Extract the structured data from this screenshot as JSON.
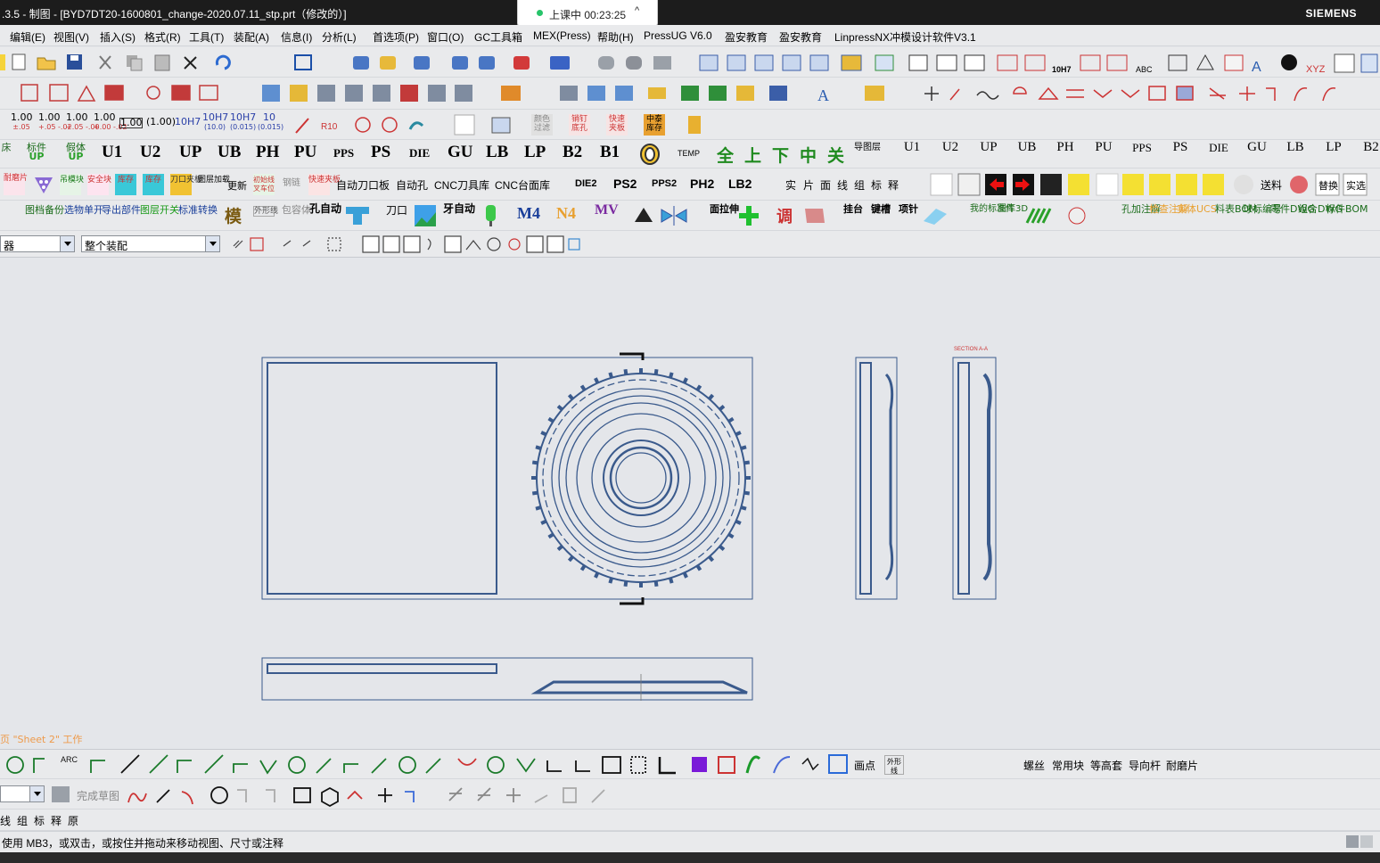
{
  "window": {
    "title": ".3.5 - 制图 - [BYD7DT20-1600801_change-2020.07.11_stp.prt（修改的）]",
    "brand": "SIEMENS"
  },
  "recording": {
    "label": "上课中 00:23:25",
    "chevron": "^"
  },
  "menu": [
    "编辑(E)",
    "视图(V)",
    "插入(S)",
    "格式(R)",
    "工具(T)",
    "装配(A)",
    "信息(I)",
    "分析(L)",
    "首选项(P)",
    "窗口(O)",
    "GC工具箱",
    "MEX(Press)",
    "帮助(H)",
    "PressUG V6.0",
    "盈安教育",
    "盈安教育",
    "LinpressNX冲模设计软件V3.1"
  ],
  "tolerance": [
    "1.00",
    "1.00",
    "1.00",
    "1.00",
    "1.00",
    "(1.00)",
    "10H7",
    "10H7",
    "10H7",
    "10"
  ],
  "row4_big": [
    "U1",
    "U2",
    "UP",
    "UB",
    "PH",
    "PU",
    "PPS",
    "PS",
    "DIE",
    "GU",
    "LB",
    "LP",
    "B2",
    "B1"
  ],
  "row4_small": [
    "U1",
    "U2",
    "UP",
    "UB",
    "PH",
    "PU",
    "PPS",
    "PS",
    "DIE",
    "GU",
    "LB",
    "LP",
    "B2"
  ],
  "row4_misc": {
    "left1": "床",
    "left2": "标件",
    "left3": "假体",
    "up": "UP",
    "temp": "TEMP",
    "quan": "全",
    "shang": "上",
    "xia": "下",
    "zhong": "中",
    "guan": "关",
    "tuceng": "导图层"
  },
  "row5": {
    "chips": [
      "耐磨片",
      "",
      "吊模块",
      "安全块",
      "库存",
      "库存",
      "刀口夹板",
      "图层加载",
      "更新",
      "",
      "钢链",
      "快速夹板"
    ],
    "text": [
      "自动刀口板",
      "自动孔",
      "CNC刀具库",
      "CNC台面库"
    ],
    "die": [
      "DIE2",
      "PS2",
      "PPS2",
      "PH2",
      "LB2"
    ],
    "mid": [
      "实",
      "片",
      "面",
      "线",
      "组",
      "标",
      "释"
    ],
    "right": [
      "",
      "",
      "送料",
      "",
      "替换",
      "实选"
    ]
  },
  "row6": {
    "a": [
      "图档备份",
      "选物单开",
      "导出部件",
      "图层开关",
      "标准转换"
    ],
    "mo": "模",
    "b": [
      "外形线",
      "包容体",
      "孔自动"
    ],
    "c": [
      "刀口",
      "牙自动"
    ],
    "m4": "M4",
    "n4": "N4",
    "mv": "MV",
    "d": [
      "面拉伸",
      "调",
      "挂台",
      "键槽",
      "项针"
    ],
    "e": [
      "我的标准件",
      "图库3D"
    ],
    "f": [
      "孔加注解",
      "检查注解",
      "实体UCS",
      "料表BOM",
      "球标编号",
      "零件DWG",
      "组合DWG",
      "标件BOM"
    ]
  },
  "selectors": {
    "filter": "器",
    "scope": "整个装配"
  },
  "drawing": {
    "section_label": "SECTION A-A"
  },
  "sheet_label": "页 \"Sheet 2\" 工作",
  "sketch_bar": {
    "finish": "完成草图",
    "right": [
      "画点",
      "",
      "螺丝",
      "常用块",
      "等高套",
      "导向杆",
      "耐磨片"
    ]
  },
  "annot_bar": [
    "线",
    "组",
    "标",
    "释",
    "原"
  ],
  "status": "使用 MB3，或双击，或按住并拖动来移动视图、尺寸或注释"
}
